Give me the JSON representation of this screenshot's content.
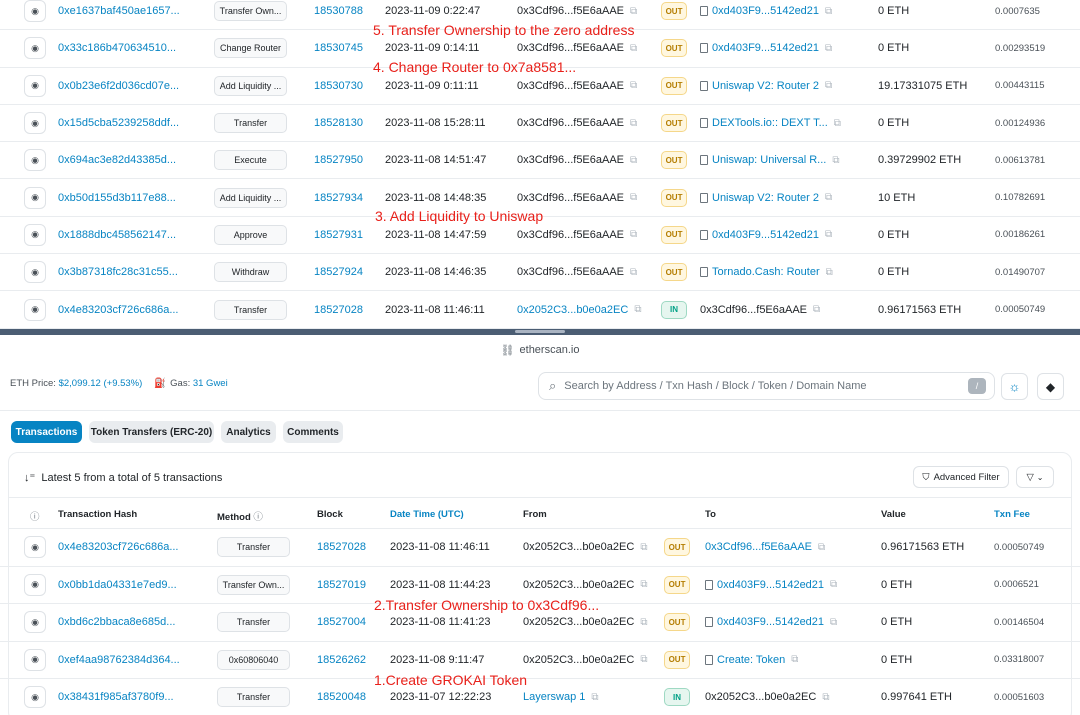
{
  "top_rows": [
    {
      "hash": "0xe1637baf450ae1657...",
      "method": "Transfer Own...",
      "block": "18530788",
      "datetime": "2023-11-09 0:22:47",
      "from": "0x3Cdf96...f5E6aAAE",
      "from_link": false,
      "dir": "OUT",
      "to": "0xd403F9...5142ed21",
      "to_doc": true,
      "to_link": true,
      "value": "0 ETH",
      "fee": "0.0007635"
    },
    {
      "hash": "0x33c186b470634510...",
      "method": "Change Router",
      "block": "18530745",
      "datetime": "2023-11-09 0:14:11",
      "from": "0x3Cdf96...f5E6aAAE",
      "from_link": false,
      "dir": "OUT",
      "to": "0xd403F9...5142ed21",
      "to_doc": true,
      "to_link": true,
      "value": "0 ETH",
      "fee": "0.00293519"
    },
    {
      "hash": "0x0b23e6f2d036cd07e...",
      "method": "Add Liquidity ...",
      "block": "18530730",
      "datetime": "2023-11-09 0:11:11",
      "from": "0x3Cdf96...f5E6aAAE",
      "from_link": false,
      "dir": "OUT",
      "to": "Uniswap V2: Router 2",
      "to_doc": true,
      "to_link": true,
      "value": "19.17331075 ETH",
      "fee": "0.00443115"
    },
    {
      "hash": "0x15d5cba5239258ddf...",
      "method": "Transfer",
      "block": "18528130",
      "datetime": "2023-11-08 15:28:11",
      "from": "0x3Cdf96...f5E6aAAE",
      "from_link": false,
      "dir": "OUT",
      "to": "DEXTools.io:: DEXT T...",
      "to_doc": true,
      "to_link": true,
      "value": "0 ETH",
      "fee": "0.00124936"
    },
    {
      "hash": "0x694ac3e82d43385d...",
      "method": "Execute",
      "block": "18527950",
      "datetime": "2023-11-08 14:51:47",
      "from": "0x3Cdf96...f5E6aAAE",
      "from_link": false,
      "dir": "OUT",
      "to": "Uniswap: Universal R...",
      "to_doc": true,
      "to_link": true,
      "value": "0.39729902 ETH",
      "fee": "0.00613781"
    },
    {
      "hash": "0xb50d155d3b117e88...",
      "method": "Add Liquidity ...",
      "block": "18527934",
      "datetime": "2023-11-08 14:48:35",
      "from": "0x3Cdf96...f5E6aAAE",
      "from_link": false,
      "dir": "OUT",
      "to": "Uniswap V2: Router 2",
      "to_doc": true,
      "to_link": true,
      "value": "10 ETH",
      "fee": "0.10782691"
    },
    {
      "hash": "0x1888dbc458562147...",
      "method": "Approve",
      "block": "18527931",
      "datetime": "2023-11-08 14:47:59",
      "from": "0x3Cdf96...f5E6aAAE",
      "from_link": false,
      "dir": "OUT",
      "to": "0xd403F9...5142ed21",
      "to_doc": true,
      "to_link": true,
      "value": "0 ETH",
      "fee": "0.00186261"
    },
    {
      "hash": "0x3b87318fc28c31c55...",
      "method": "Withdraw",
      "block": "18527924",
      "datetime": "2023-11-08 14:46:35",
      "from": "0x3Cdf96...f5E6aAAE",
      "from_link": false,
      "dir": "OUT",
      "to": "Tornado.Cash: Router",
      "to_doc": true,
      "to_link": true,
      "value": "0 ETH",
      "fee": "0.01490707"
    },
    {
      "hash": "0x4e83203cf726c686a...",
      "method": "Transfer",
      "block": "18527028",
      "datetime": "2023-11-08 11:46:11",
      "from": "0x2052C3...b0e0a2EC",
      "from_link": true,
      "dir": "IN",
      "to": "0x3Cdf96...f5E6aAAE",
      "to_doc": false,
      "to_link": false,
      "value": "0.96171563 ETH",
      "fee": "0.00050749"
    }
  ],
  "annotations_top": [
    "5. Transfer Ownership to the zero address",
    "4. Change Router to 0x7a8581...",
    "3. Add Liquidity to Uniswap"
  ],
  "url_bar": {
    "domain": "etherscan.io"
  },
  "header": {
    "eth_price_label": "ETH Price:",
    "eth_price_value": "$2,099.12 (+9.53%)",
    "gas_label": "Gas:",
    "gas_value": "31 Gwei",
    "search_placeholder": "Search by Address / Txn Hash / Block / Token / Domain Name",
    "slash_key": "/"
  },
  "tabs": [
    {
      "label": "Transactions",
      "active": true
    },
    {
      "label": "Token Transfers (ERC-20)",
      "active": false
    },
    {
      "label": "Analytics",
      "active": false
    },
    {
      "label": "Comments",
      "active": false
    }
  ],
  "summary": "Latest 5 from a total of 5 transactions",
  "advanced_filter": "Advanced Filter",
  "columns": {
    "hash": "Transaction Hash",
    "method": "Method",
    "block": "Block",
    "datetime": "Date Time (UTC)",
    "from": "From",
    "to": "To",
    "value": "Value",
    "fee": "Txn Fee"
  },
  "bottom_rows": [
    {
      "hash": "0x4e83203cf726c686a...",
      "method": "Transfer",
      "block": "18527028",
      "datetime": "2023-11-08 11:46:11",
      "from": "0x2052C3...b0e0a2EC",
      "from_link": false,
      "dir": "OUT",
      "to": "0x3Cdf96...f5E6aAAE",
      "to_doc": false,
      "to_link": true,
      "value": "0.96171563 ETH",
      "fee": "0.00050749"
    },
    {
      "hash": "0x0bb1da04331e7ed9...",
      "method": "Transfer Own...",
      "block": "18527019",
      "datetime": "2023-11-08 11:44:23",
      "from": "0x2052C3...b0e0a2EC",
      "from_link": false,
      "dir": "OUT",
      "to": "0xd403F9...5142ed21",
      "to_doc": true,
      "to_link": true,
      "value": "0 ETH",
      "fee": "0.0006521"
    },
    {
      "hash": "0xbd6c2bbaca8e685d...",
      "method": "Transfer",
      "block": "18527004",
      "datetime": "2023-11-08 11:41:23",
      "from": "0x2052C3...b0e0a2EC",
      "from_link": false,
      "dir": "OUT",
      "to": "0xd403F9...5142ed21",
      "to_doc": true,
      "to_link": true,
      "value": "0 ETH",
      "fee": "0.00146504"
    },
    {
      "hash": "0xef4aa98762384d364...",
      "method": "0x60806040",
      "block": "18526262",
      "datetime": "2023-11-08 9:11:47",
      "from": "0x2052C3...b0e0a2EC",
      "from_link": false,
      "dir": "OUT",
      "to": "Create: Token",
      "to_doc": true,
      "to_link": true,
      "value": "0 ETH",
      "fee": "0.03318007"
    },
    {
      "hash": "0x38431f985af3780f9...",
      "method": "Transfer",
      "block": "18520048",
      "datetime": "2023-11-07 12:22:23",
      "from": "Layerswap 1",
      "from_link": true,
      "dir": "IN",
      "to": "0x2052C3...b0e0a2EC",
      "to_doc": false,
      "to_link": false,
      "value": "0.997641 ETH",
      "fee": "0.00051603"
    }
  ],
  "annotations_bottom": [
    "2.Transfer Ownership to 0x3Cdf96...",
    "1.Create GROKAI Token"
  ],
  "colors": {
    "link": "#0784c3",
    "annotation": "#e8201a",
    "out": "#b47d00",
    "in": "#00a186"
  }
}
